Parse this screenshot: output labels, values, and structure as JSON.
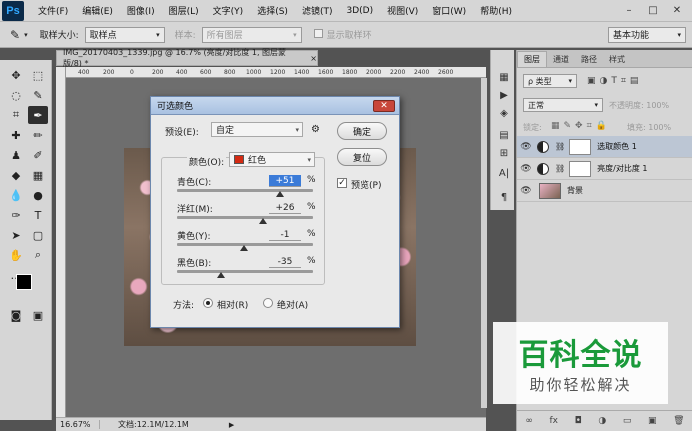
{
  "app": {
    "logo": "Ps",
    "menu": [
      "文件(F)",
      "编辑(E)",
      "图像(I)",
      "图层(L)",
      "文字(Y)",
      "选择(S)",
      "滤镜(T)",
      "3D(D)",
      "视图(V)",
      "窗口(W)",
      "帮助(H)"
    ],
    "window_controls": [
      "–",
      "□",
      "✕"
    ]
  },
  "options_bar": {
    "sample_size_label": "取样大小:",
    "sample_size_value": "取样点",
    "sample_label": "样本:",
    "sample_value": "所有图层",
    "show_ring_label": "显示取样环",
    "workspace": "基本功能"
  },
  "document": {
    "tab_title": "IMG_20170403_1339.jpg @ 16.7% (亮度/对比度 1, 图层蒙版/8) *",
    "tab_close": "×",
    "zoom": "16.67%",
    "doc_info": "文档:12.1M/12.1M",
    "ruler_ticks": [
      "400",
      "200",
      "0",
      "200",
      "400",
      "600",
      "800",
      "1000",
      "1200",
      "1400",
      "1600",
      "1800",
      "2000",
      "2200",
      "2400",
      "2600"
    ]
  },
  "dialog": {
    "title": "可选颜色",
    "close": "✕",
    "preset_label": "预设(E):",
    "preset_value": "自定",
    "ok": "确定",
    "reset": "复位",
    "preview_label": "预览(P)",
    "preview_checked": "✓",
    "colors_label": "颜色(O):",
    "colors_value": "红色",
    "swatch_color": "#d42a12",
    "sliders": [
      {
        "label": "青色(C):",
        "value": "+51",
        "unit": "%",
        "level": 0.755
      },
      {
        "label": "洋红(M):",
        "value": "+26",
        "unit": "%",
        "level": 0.63
      },
      {
        "label": "黄色(Y):",
        "value": "-1",
        "unit": "%",
        "level": 0.495
      },
      {
        "label": "黑色(B):",
        "value": "-35",
        "unit": "%",
        "level": 0.325
      }
    ],
    "method_label": "方法:",
    "relative_label": "相对(R)",
    "absolute_label": "绝对(A)"
  },
  "layers_panel": {
    "tabs": [
      "图层",
      "通道",
      "路径",
      "样式"
    ],
    "filter_value": "ρ 类型",
    "blend_mode": "正常",
    "opacity_label": "不透明度: 100%",
    "lock_label": "锁定:",
    "fill_label": "填充: 100%",
    "layers": [
      {
        "name": "选取颜色 1",
        "active": true
      },
      {
        "name": "亮度/对比度 1",
        "active": false
      },
      {
        "name": "背景",
        "active": false
      }
    ],
    "eye": "👁",
    "footer_icons": [
      "∞",
      "fx",
      "◘",
      "◑",
      "▭",
      "▣",
      "🗑"
    ]
  },
  "watermark": {
    "main": "百科全说",
    "sub": "助你轻松解决"
  }
}
